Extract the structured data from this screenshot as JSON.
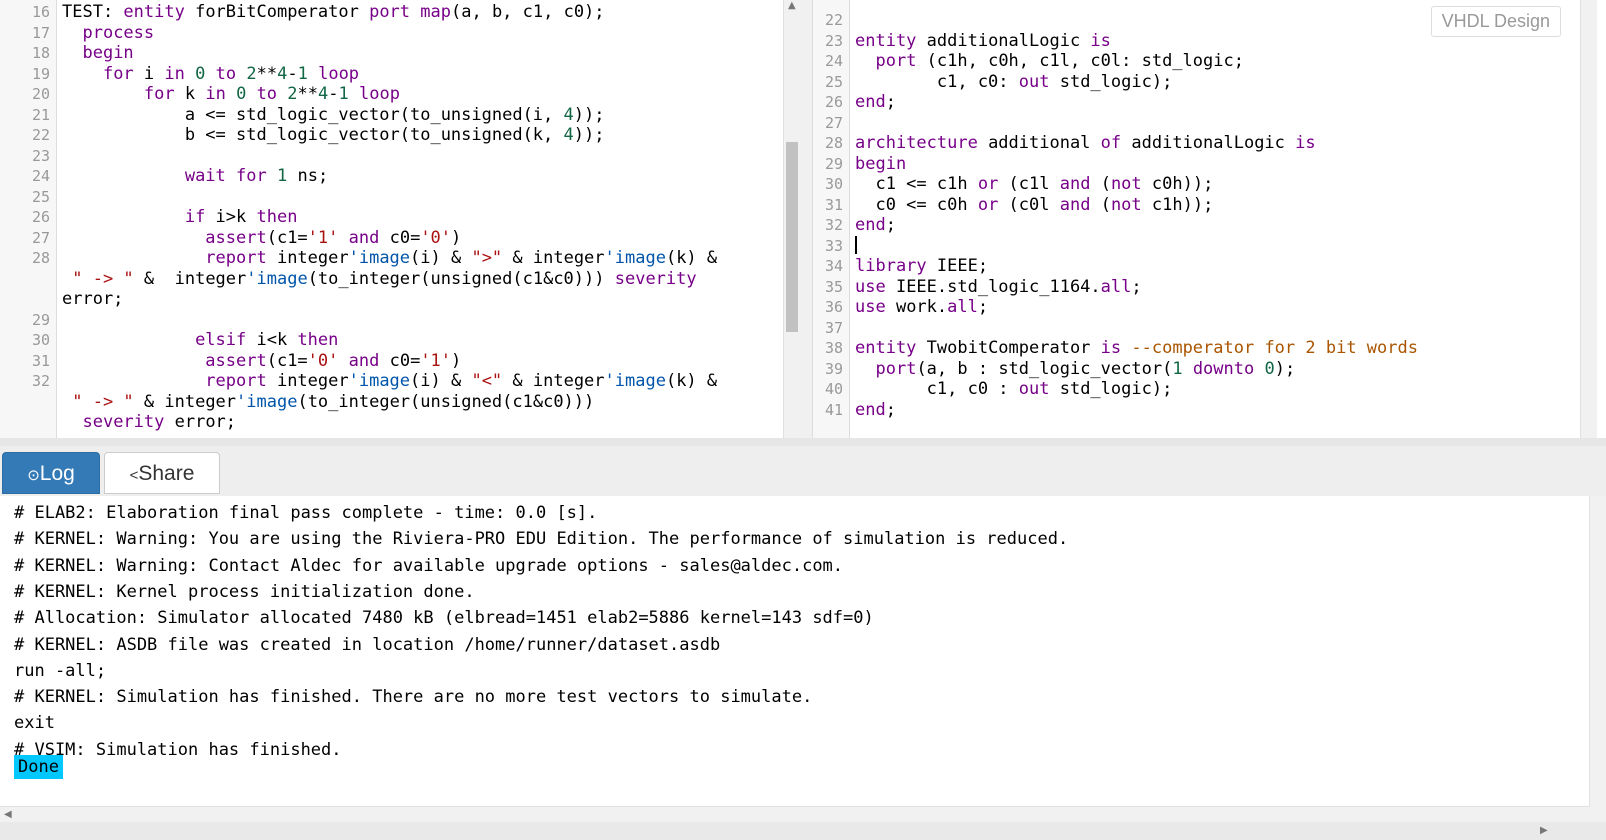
{
  "badge": "VHDL Design",
  "left_editor": {
    "lines": [
      {
        "n": "16",
        "t": "TEST: entity forBitComperator port map(a, b, c1, c0);"
      },
      {
        "n": "17",
        "t": "  process"
      },
      {
        "n": "18",
        "t": "  begin"
      },
      {
        "n": "19",
        "t": "    for i in 0 to 2**4-1 loop"
      },
      {
        "n": "20",
        "t": "        for k in 0 to 2**4-1 loop"
      },
      {
        "n": "21",
        "t": "            a <= std_logic_vector(to_unsigned(i, 4));"
      },
      {
        "n": "22",
        "t": "            b <= std_logic_vector(to_unsigned(k, 4));"
      },
      {
        "n": "23",
        "t": ""
      },
      {
        "n": "24",
        "t": "            wait for 1 ns;"
      },
      {
        "n": "25",
        "t": ""
      },
      {
        "n": "26",
        "t": "            if i>k then"
      },
      {
        "n": "27",
        "t": "              assert(c1='1' and c0='0')"
      },
      {
        "n": "28",
        "t": "              report integer'image(i) & \">\" & integer'image(k) &"
      },
      {
        "n": "",
        "t": " \" -> \" &  integer'image(to_integer(unsigned(c1&c0))) severity"
      },
      {
        "n": "",
        "t": "error;"
      },
      {
        "n": "29",
        "t": ""
      },
      {
        "n": "30",
        "t": "             elsif i<k then"
      },
      {
        "n": "31",
        "t": "              assert(c1='0' and c0='1')"
      },
      {
        "n": "32",
        "t": "              report integer'image(i) & \"<\" & integer'image(k) &"
      },
      {
        "n": "",
        "t": " \" -> \" & integer'image(to_integer(unsigned(c1&c0)))"
      },
      {
        "n": "",
        "t": "  severity error;"
      }
    ]
  },
  "right_editor": {
    "lines": [
      {
        "n": "22",
        "t": ""
      },
      {
        "n": "23",
        "t": "entity additionalLogic is"
      },
      {
        "n": "24",
        "t": "  port (c1h, c0h, c1l, c0l: std_logic;"
      },
      {
        "n": "25",
        "t": "        c1, c0: out std_logic);"
      },
      {
        "n": "26",
        "t": "end;"
      },
      {
        "n": "27",
        "t": ""
      },
      {
        "n": "28",
        "t": "architecture additional of additionalLogic is"
      },
      {
        "n": "29",
        "t": "begin"
      },
      {
        "n": "30",
        "t": "  c1 <= c1h or (c1l and (not c0h));"
      },
      {
        "n": "31",
        "t": "  c0 <= c0h or (c0l and (not c1h));"
      },
      {
        "n": "32",
        "t": "end;"
      },
      {
        "n": "33",
        "t": ""
      },
      {
        "n": "34",
        "t": "library IEEE;"
      },
      {
        "n": "35",
        "t": "use IEEE.std_logic_1164.all;"
      },
      {
        "n": "36",
        "t": "use work.all;"
      },
      {
        "n": "37",
        "t": ""
      },
      {
        "n": "38",
        "t": "entity TwobitComperator is --comperator for 2 bit words"
      },
      {
        "n": "39",
        "t": "  port(a, b : std_logic_vector(1 downto 0);"
      },
      {
        "n": "40",
        "t": "       c1, c0 : out std_logic);"
      },
      {
        "n": "41",
        "t": "end;"
      }
    ]
  },
  "tabs": {
    "log_label": "Log",
    "share_label": "Share",
    "log_icon": "play-circle-icon",
    "share_icon": "share-icon"
  },
  "log": {
    "lines": [
      "# ELAB2: Elaboration final pass complete - time: 0.0 [s].",
      "# KERNEL: Warning: You are using the Riviera-PRO EDU Edition. The performance of simulation is reduced.",
      "# KERNEL: Warning: Contact Aldec for available upgrade options - sales@aldec.com.",
      "# KERNEL: Kernel process initialization done.",
      "# Allocation: Simulator allocated 7480 kB (elbread=1451 elab2=5886 kernel=143 sdf=0)",
      "# KERNEL: ASDB file was created in location /home/runner/dataset.asdb",
      "run -all;",
      "# KERNEL: Simulation has finished. There are no more test vectors to simulate.",
      "exit",
      "# VSIM: Simulation has finished."
    ],
    "done": "Done"
  },
  "colors": {
    "keyword": "#770088",
    "number": "#116644",
    "string": "#aa1111",
    "attribute": "#0055aa",
    "comment": "#aa5500",
    "active_tab": "#337ab7",
    "done_highlight": "#00c8ff"
  }
}
